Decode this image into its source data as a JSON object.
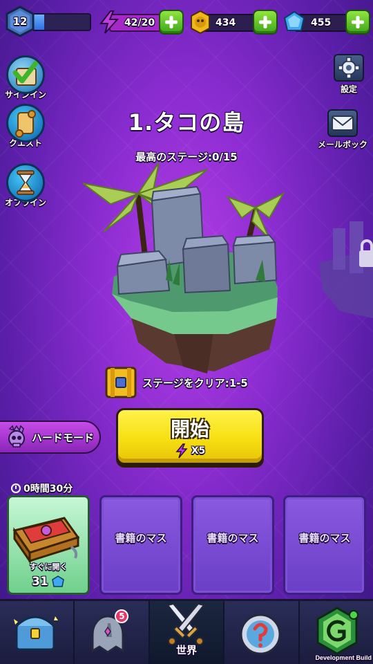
{
  "topbar": {
    "level": "12",
    "xp_fraction": 0.2,
    "energy": "42/20",
    "gold": "434",
    "gems": "455"
  },
  "left_menu": {
    "signin": "サインイン",
    "quest": "クエスト",
    "offline": "オフライン"
  },
  "right_menu": {
    "settings": "設定",
    "mailbox": "メールボック"
  },
  "stage": {
    "title": "1.タコの島",
    "best": "最高のステージ:0/15",
    "clear_reward": "ステージをクリア:1-5"
  },
  "hard_mode": "ハードモード",
  "start_button": {
    "label": "開始",
    "cost": "X5"
  },
  "chests": {
    "timer": "0時間30分",
    "open_now": "すぐに開く",
    "gem_cost": "31",
    "slots": [
      "書籍のマス",
      "書籍のマス",
      "書籍のマス"
    ]
  },
  "nav": {
    "world": "世界",
    "helmet_badge": "5",
    "dev_build": "Development Build"
  },
  "colors": {
    "bg_center": "#b43ee6",
    "bg_edge": "#3a1680",
    "start_yellow": "#f6df12",
    "plus_green": "#3fa51c"
  }
}
